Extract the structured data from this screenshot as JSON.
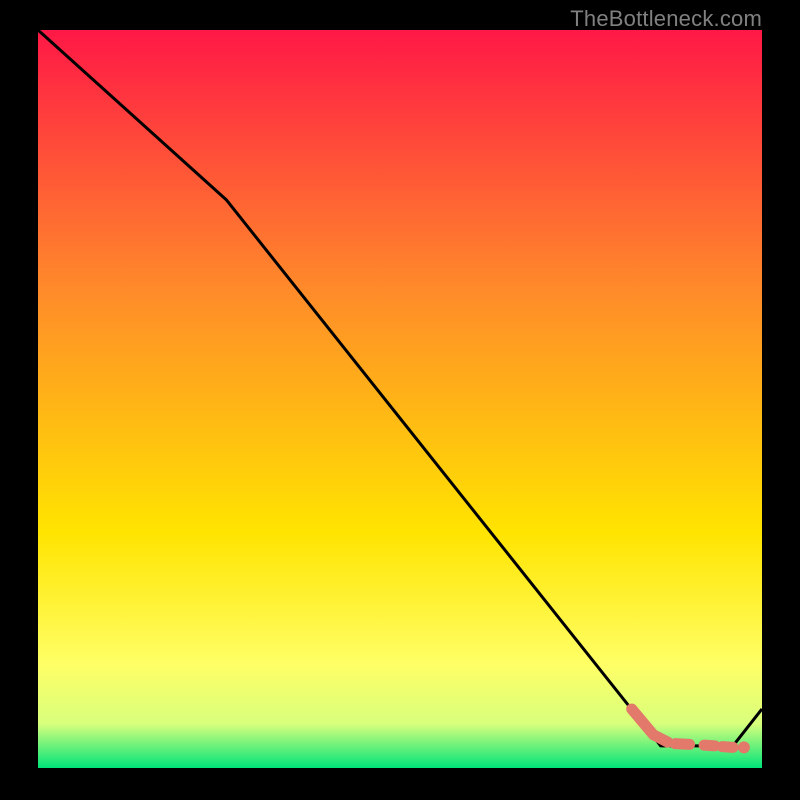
{
  "watermark": "TheBottleneck.com",
  "colors": {
    "frame": "#000000",
    "gradient_top": "#ff1846",
    "gradient_mid1": "#ff8a2a",
    "gradient_mid2": "#ffe400",
    "gradient_low1": "#ffff66",
    "gradient_low2": "#d8ff7c",
    "gradient_bottom": "#00e47a",
    "curve": "#000000",
    "salmon": "#e2796b"
  },
  "chart_data": {
    "type": "line",
    "title": "",
    "xlabel": "",
    "ylabel": "",
    "xlim": [
      0,
      100
    ],
    "ylim": [
      0,
      100
    ],
    "series": [
      {
        "name": "main-curve",
        "x": [
          0,
          26,
          86,
          96,
          100
        ],
        "y": [
          100,
          77,
          3,
          3,
          8
        ]
      },
      {
        "name": "salmon-segment-1",
        "x": [
          82,
          85,
          87
        ],
        "y": [
          8,
          4.5,
          3.5
        ]
      },
      {
        "name": "salmon-segment-2",
        "x": [
          88,
          90
        ],
        "y": [
          3.3,
          3.2
        ]
      },
      {
        "name": "salmon-segment-3",
        "x": [
          92,
          93.5
        ],
        "y": [
          3.1,
          3
        ]
      },
      {
        "name": "salmon-segment-4",
        "x": [
          94.5,
          96
        ],
        "y": [
          2.9,
          2.8
        ]
      },
      {
        "name": "salmon-point",
        "x": [
          97.5
        ],
        "y": [
          2.8
        ]
      }
    ]
  }
}
